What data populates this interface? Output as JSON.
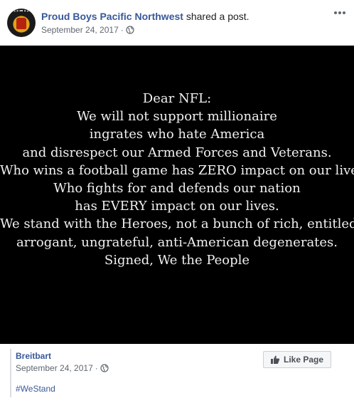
{
  "post": {
    "author": "Proud Boys Pacific Northwest",
    "action": "shared a post.",
    "date": "September 24, 2017",
    "separator": "·",
    "privacy_icon": "globe-icon",
    "more_icon": "more-options-icon"
  },
  "image": {
    "background": "#000000",
    "text_color": "#f0f0f0",
    "lines": [
      "Dear NFL:",
      "We will not support millionaire",
      "ingrates who hate America",
      "and disrespect our Armed Forces and Veterans.",
      "Who wins a football game has ZERO impact on our lives.",
      "Who fights for and defends our nation",
      "has EVERY impact on our lives.",
      "We stand with the Heroes, not a bunch of rich, entitled,",
      "arrogant, ungrateful, anti-American degenerates.",
      "Signed, We the People"
    ]
  },
  "shared": {
    "source": "Breitbart",
    "date": "September 24, 2017",
    "separator": "·",
    "hashtag": "#WeStand",
    "like_button_label": "Like Page",
    "like_icon": "thumbs-up-icon"
  },
  "colors": {
    "link": "#385898",
    "meta": "#606770"
  }
}
